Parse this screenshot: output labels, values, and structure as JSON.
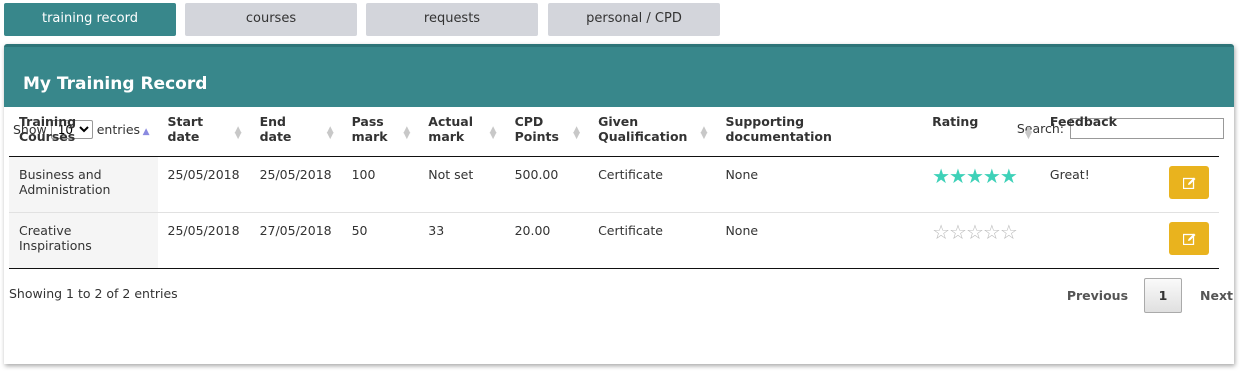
{
  "tabs": [
    {
      "label": "training record",
      "active": true
    },
    {
      "label": "courses",
      "active": false
    },
    {
      "label": "requests",
      "active": false
    },
    {
      "label": "personal / CPD",
      "active": false
    }
  ],
  "panel": {
    "title": "My Training Record"
  },
  "controls": {
    "show_label": "Show",
    "entries_value": "10",
    "entries_label": "entries",
    "search_label": "Search:",
    "search_value": ""
  },
  "table": {
    "headers": [
      "Training Courses",
      "Start\ndate",
      "End date",
      "Pass\nmark",
      "Actual\nmark",
      "CPD\nPoints",
      "Given\nQualification",
      "Supporting documentation",
      "Rating",
      "Feedback"
    ],
    "rows": [
      {
        "course": "Business and Administration",
        "start": "25/05/2018",
        "end": "25/05/2018",
        "pass": "100",
        "actual": "Not set",
        "cpd": "500.00",
        "qualification": "Certificate",
        "docs": "None",
        "rating": 5,
        "feedback": "Great!"
      },
      {
        "course": "Creative Inspirations",
        "start": "25/05/2018",
        "end": "27/05/2018",
        "pass": "50",
        "actual": "33",
        "cpd": "20.00",
        "qualification": "Certificate",
        "docs": "None",
        "rating": 0,
        "feedback": ""
      }
    ]
  },
  "footer": {
    "info": "Showing 1 to 2 of 2 entries"
  },
  "pager": {
    "previous": "Previous",
    "page": "1",
    "next": "Next"
  },
  "colors": {
    "accent": "#38878b",
    "edit": "#e9b31e",
    "star": "#3ed1b8"
  }
}
